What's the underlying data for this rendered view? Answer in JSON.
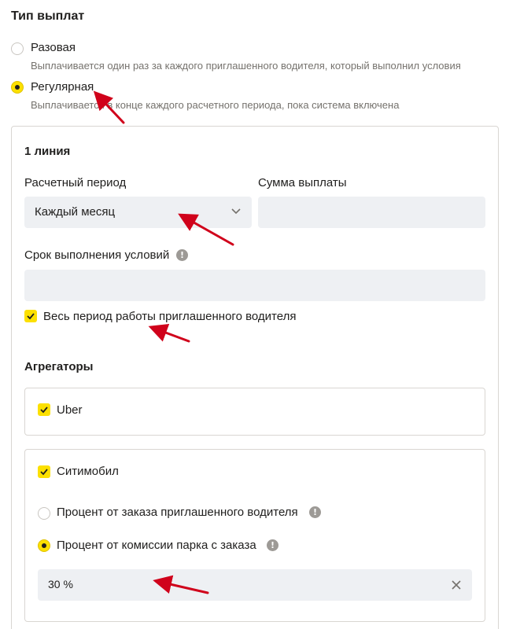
{
  "payout_type": {
    "title": "Тип выплат",
    "options": [
      {
        "label": "Разовая",
        "description": "Выплачивается один раз за каждого приглашенного водителя, который выполнил условия",
        "selected": false
      },
      {
        "label": "Регулярная",
        "description": "Выплачивается в конце каждого расчетного периода, пока система включена",
        "selected": true
      }
    ]
  },
  "line": {
    "title": "1 линия",
    "period": {
      "label": "Расчетный период",
      "value": "Каждый месяц"
    },
    "amount": {
      "label": "Сумма выплаты",
      "value": ""
    },
    "deadline": {
      "label": "Срок выполнения условий",
      "value": ""
    },
    "whole_period": {
      "label": "Весь период работы приглашенного водителя",
      "checked": true
    }
  },
  "aggregators": {
    "title": "Агрегаторы",
    "uber": {
      "label": "Uber",
      "checked": true
    },
    "citymobil": {
      "label": "Ситимобил",
      "checked": true,
      "options": [
        {
          "label": "Процент от заказа приглашенного водителя",
          "selected": false
        },
        {
          "label": "Процент от комиссии парка с заказа",
          "selected": true
        }
      ],
      "percent_value": "30 %"
    }
  },
  "colors": {
    "accent": "#fce000",
    "annotation_arrow": "#d0021b",
    "field_bg": "#eef0f3"
  }
}
